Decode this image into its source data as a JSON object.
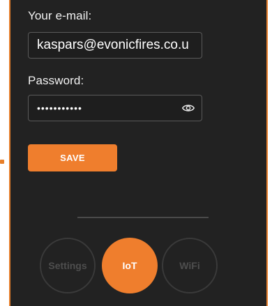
{
  "form": {
    "email_label": "Your e-mail:",
    "email_value": "kaspars@evonicfires.co.u",
    "password_label": "Password:",
    "password_value": "•••••••••••",
    "password_toggle_icon": "eye-icon",
    "save_label": "SAVE"
  },
  "nav": {
    "items": [
      {
        "label": "Settings",
        "active": false
      },
      {
        "label": "IoT",
        "active": true
      },
      {
        "label": "WiFi",
        "active": false
      }
    ]
  },
  "colors": {
    "accent": "#ef7e2d",
    "background": "#222222",
    "border": "#e77f2a"
  }
}
